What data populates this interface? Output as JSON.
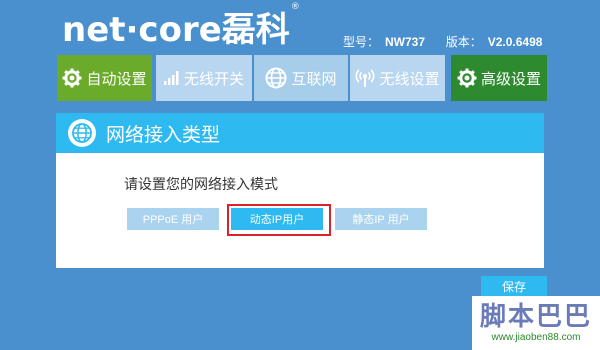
{
  "brand": {
    "logo_text": "net·core磊科",
    "registered": "®"
  },
  "version_info": {
    "model_label": "型号：",
    "model_value": "NW737",
    "version_label": "版本：",
    "version_value": "V2.0.6498"
  },
  "nav": {
    "items": [
      {
        "label": "自动设置",
        "icon": "gear-icon"
      },
      {
        "label": "无线开关",
        "icon": "signal-bars-icon"
      },
      {
        "label": "互联网",
        "icon": "globe-icon"
      },
      {
        "label": "无线设置",
        "icon": "wireless-icon"
      },
      {
        "label": "高级设置",
        "icon": "gear-icon"
      }
    ]
  },
  "panel": {
    "title": "网络接入类型",
    "prompt": "请设置您的网络接入模式",
    "modes": [
      {
        "label": "PPPoE 用户",
        "selected": false
      },
      {
        "label": "动态IP用户",
        "selected": true
      },
      {
        "label": "静态IP 用户",
        "selected": false
      }
    ]
  },
  "save_label": "保存",
  "watermark": {
    "main": "脚本巴巴",
    "sub": "www.jiaoben88.com"
  },
  "colors": {
    "background": "#4a90cf",
    "accent": "#2ebaf0",
    "nav_green": "#6bab2c",
    "nav_dark_green": "#2e8a2e",
    "nav_light": "#b9d6f1",
    "highlight_red": "#d9232e"
  }
}
